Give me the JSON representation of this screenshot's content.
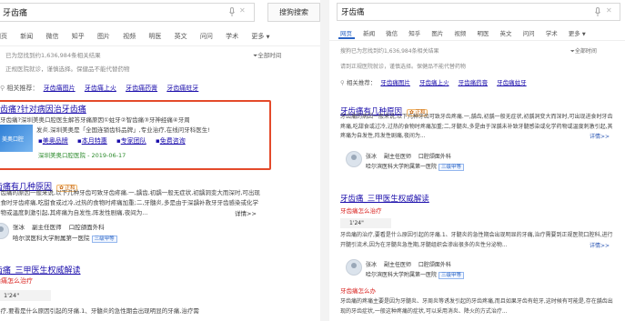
{
  "left": {
    "search_value": "牙齿痛",
    "search_button": "搜狗搜索",
    "tabs": [
      "网页",
      "新闻",
      "微信",
      "知乎",
      "图片",
      "视频",
      "明医",
      "英文",
      "问问",
      "学术",
      "更多"
    ],
    "result_count": "已为您找到约1,636,984条相关结果",
    "filter_label": "全部时间",
    "notice": "正规医院就诊，谨慎选择。保健品不能代替药物",
    "related_label": "相关推荐：",
    "related": [
      "牙齿痛图片",
      "牙齿痛上火",
      "牙齿痛药膏",
      "牙齿痛蛀牙"
    ],
    "ad": {
      "title": "齿痛?针对病因治牙齿痛",
      "line1": "牙齿痛?深圳美奥口腔医生解答牙痛原因①蛀牙②智齿痛③牙神经痛④牙周",
      "line2": "发炎.深圳美奥是「全国连锁齿科品牌」,专业治疗,在线问牙科医生!",
      "image_text": "美奥口腔",
      "links": [
        "美奥品牌",
        "本月特惠",
        "专家团队",
        "免费咨询"
      ],
      "site": "深圳美奥口腔医院 - 2019-06-17"
    },
    "result1": {
      "title": "齿痛有几种原因",
      "badge": "✿ 正和",
      "snippet": "牙齿痛的原因一般来说,以下几种牙齿可致牙齿疼痛.一,龋齿,初龋一般无症状,初龋洞变大而深时,可出现进食时牙齿疼痛,吃甜食或过冷,过热的食物时疼痛加重;二,牙髓炎,多是由于深龋补救牙牙齿感染或化学药物或温度刺激引起,其疼痛为自发性,阵发性剧痛,夜间为...",
      "snippet_more": "详情>>",
      "doctor_name": "张冰",
      "doctor_title": "副主任医师",
      "doctor_dept": "口腔颌面外科",
      "hospital": "哈尔滨医科大学附属第一医院",
      "hospital_badge": "三级甲等"
    },
    "result2": {
      "title": "齿痛_三甲医生权威解读",
      "q1": "齿痛怎么治疗",
      "audio": "1'24\"",
      "snippet2": "治疗,要看是什么原因引起的牙痛.1、牙髓炎的急性期会出现明显的牙痛,治疗需"
    }
  },
  "right": {
    "search_value": "牙齿痛",
    "tabs": [
      "网页",
      "新闻",
      "微信",
      "知乎",
      "图片",
      "视频",
      "明医",
      "英文",
      "问问",
      "学术",
      "更多"
    ],
    "result_count": "搜狗已为您找到约1,636,984条相关结果",
    "filter_label": "全部时间",
    "notice": "请到正规医院就诊，谨慎选择。保健品不能代替药物",
    "related_label": "相关推荐：",
    "related": [
      "牙齿痛图片",
      "牙齿痛上火",
      "牙齿痛药膏",
      "牙齿痛蛀牙"
    ],
    "result1": {
      "title": "牙齿痛有几种原因",
      "badge": "✿ 正和",
      "snippet": "牙齿痛的病因一般来说,以下几种牙齿可致牙齿疼痛.一,龋齿,初龋一般无症状,初龋洞变大而深时,可出现进食时牙齿疼痛,吃甜食或过冷,过热的食物时疼痛加重;二,牙髓炎,多是由于深龋未补致牙髓感染或化学药物或温度刺激引起,其疼痛为自发性,阵发性剧痛,夜间为...",
      "snippet_more": "详情>>",
      "doctor_name": "张冰",
      "doctor_title": "副主任医师",
      "doctor_dept": "口腔颌面外科",
      "hospital": "哈尔滨医科大学附属第一医院",
      "hospital_badge": "三级甲等"
    },
    "result2": {
      "title": "牙齿痛_三甲医生权威解读",
      "q1": "牙齿痛怎么治疗",
      "audio": "1'24\"",
      "snippet": "牙齿痛的治疗,要看是什么原因引起的牙痛.1、牙髓炎的急性期会出现明显的牙痛,治疗需要到正规医院口腔科,进行开髓引流术,因为在牙髓炎急性期,牙髓组织会渗出很多的炎性分泌物...",
      "snippet_more": "详情>>",
      "doctor_name": "张冰",
      "doctor_title": "副主任医师",
      "doctor_dept": "口腔颌面外科",
      "hospital": "哈尔滨医科大学附属第一医院",
      "hospital_badge": "三级甲等",
      "q2": "牙齿痛怎么办",
      "snippet3": "牙齿痛的疼痛主要是因为牙髓炎、牙周炎等诱发引起的牙齿疼痛,而且如果牙齿有蛀牙,这时候有可能是,存在龋齿出现的牙齿症状,一般这种疼痛的症状,可以采用消炎、降火的方式治疗..."
    }
  }
}
